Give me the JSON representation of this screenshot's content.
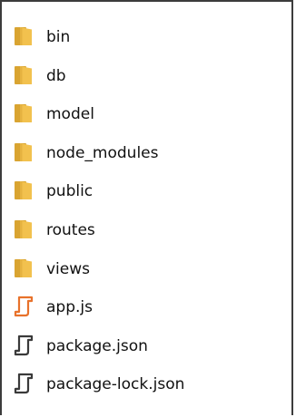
{
  "explorer": {
    "items": [
      {
        "label": "bin",
        "type": "folder",
        "icon": "folder-icon"
      },
      {
        "label": "db",
        "type": "folder",
        "icon": "folder-icon"
      },
      {
        "label": "model",
        "type": "folder",
        "icon": "folder-icon"
      },
      {
        "label": "node_modules",
        "type": "folder",
        "icon": "folder-icon"
      },
      {
        "label": "public",
        "type": "folder",
        "icon": "folder-icon"
      },
      {
        "label": "routes",
        "type": "folder",
        "icon": "folder-icon"
      },
      {
        "label": "views",
        "type": "folder",
        "icon": "folder-icon"
      },
      {
        "label": "app.js",
        "type": "js-file",
        "icon": "js-file-icon"
      },
      {
        "label": "package.json",
        "type": "json-file",
        "icon": "json-file-icon"
      },
      {
        "label": "package-lock.json",
        "type": "json-file",
        "icon": "json-file-icon"
      }
    ]
  },
  "colors": {
    "folder_front": "#f2c14e",
    "folder_back": "#d9a431",
    "js_file": "#e8722b",
    "json_file": "#3a3a3a",
    "border": "#3c3c3c"
  }
}
